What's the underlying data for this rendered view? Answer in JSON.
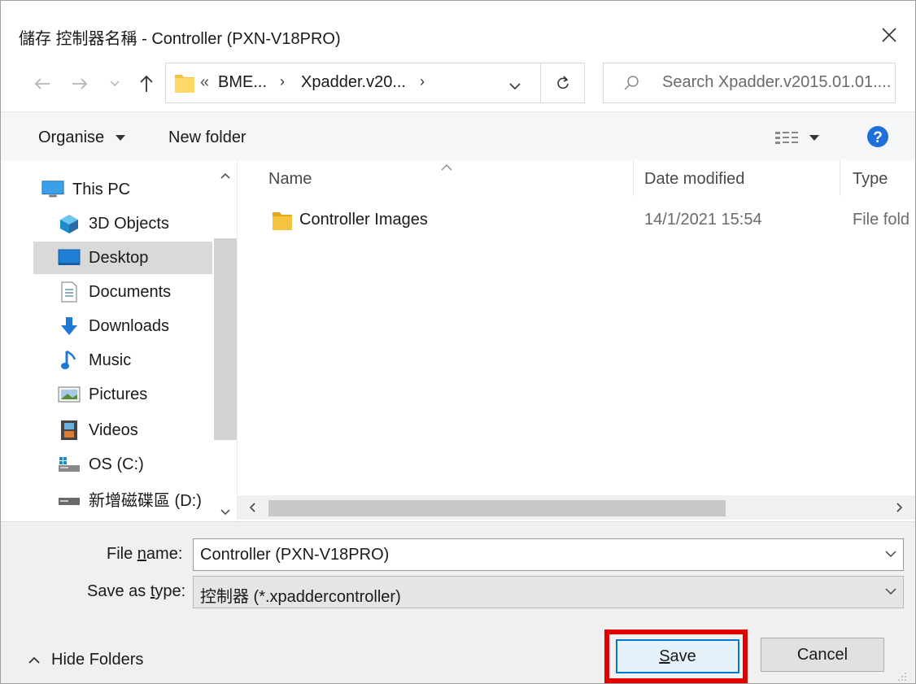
{
  "window": {
    "title": "儲存 控制器名稱 - Controller (PXN-V18PRO)",
    "close_icon": "close-icon"
  },
  "nav": {
    "address_crumbs": [
      "BME...",
      "Xpadder.v20..."
    ],
    "overflow_label": "«",
    "search_placeholder": "Search Xpadder.v2015.01.01...."
  },
  "commands": {
    "organise_label": "Organise",
    "new_folder_label": "New folder"
  },
  "sidebar": {
    "items": [
      {
        "label": "This PC",
        "icon": "computer-icon"
      },
      {
        "label": "3D Objects",
        "icon": "3d-objects-icon"
      },
      {
        "label": "Desktop",
        "icon": "desktop-icon",
        "selected": true
      },
      {
        "label": "Documents",
        "icon": "documents-icon"
      },
      {
        "label": "Downloads",
        "icon": "downloads-icon"
      },
      {
        "label": "Music",
        "icon": "music-icon"
      },
      {
        "label": "Pictures",
        "icon": "pictures-icon"
      },
      {
        "label": "Videos",
        "icon": "videos-icon"
      },
      {
        "label": "OS (C:)",
        "icon": "drive-c-icon"
      },
      {
        "label": "新增磁碟區 (D:)",
        "icon": "drive-d-icon"
      }
    ]
  },
  "files": {
    "columns": [
      "Name",
      "Date modified",
      "Type"
    ],
    "rows": [
      {
        "name": "Controller Images",
        "date": "14/1/2021 15:54",
        "type": "File fold"
      }
    ]
  },
  "form": {
    "file_name_label_pre": "File ",
    "file_name_label_u": "n",
    "file_name_label_post": "ame:",
    "file_name_value": "Controller (PXN-V18PRO)",
    "save_type_label_pre": "Save as ",
    "save_type_label_u": "t",
    "save_type_label_post": "ype:",
    "save_type_value": "控制器 (*.xpaddercontroller)"
  },
  "footer": {
    "hide_folders_label": "Hide Folders",
    "save_label_u": "S",
    "save_label_rest": "ave",
    "cancel_label": "Cancel"
  },
  "colors": {
    "accent": "#0078d7",
    "highlight": "#e00000",
    "folder": "#f5c342"
  }
}
